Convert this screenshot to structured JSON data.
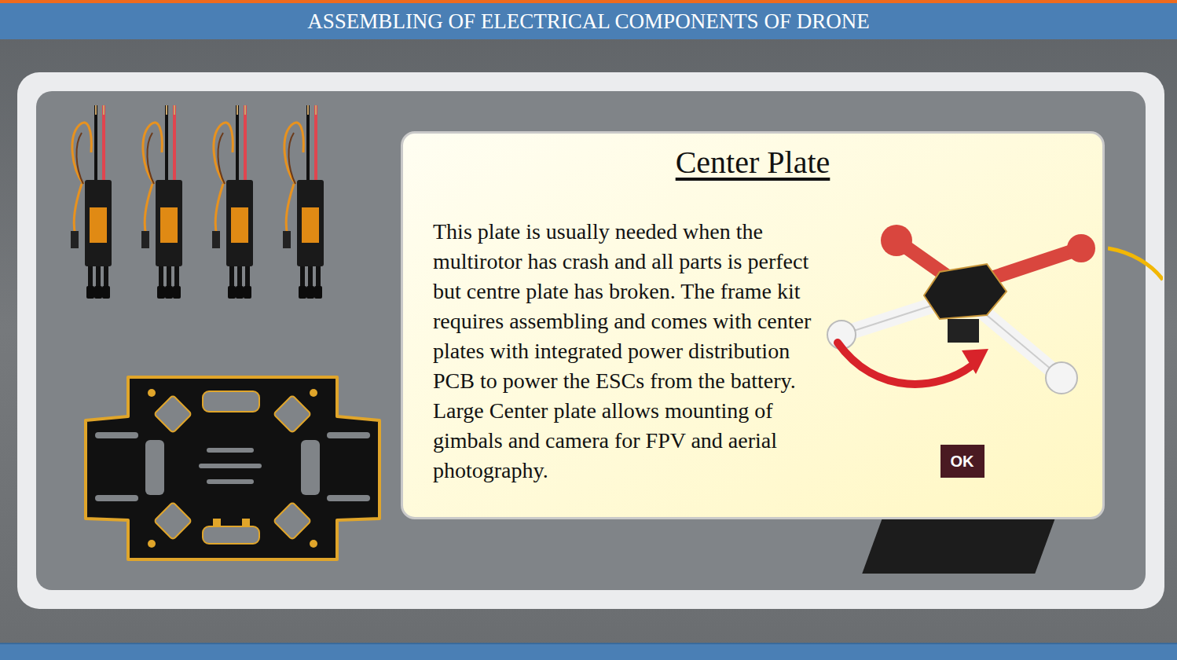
{
  "header": {
    "title": "ASSEMBLING OF ELECTRICAL COMPONENTS OF DRONE"
  },
  "dialog": {
    "title": "Center Plate",
    "body": "This plate is usually needed when the multirotor has crash and all parts is perfect but centre plate has broken. The frame kit requires assembling and comes with center plates with integrated power distribution PCB to power the ESCs from the battery. Large Center plate allows mounting of gimbals and camera for FPV and aerial photography.",
    "button": "OK"
  }
}
